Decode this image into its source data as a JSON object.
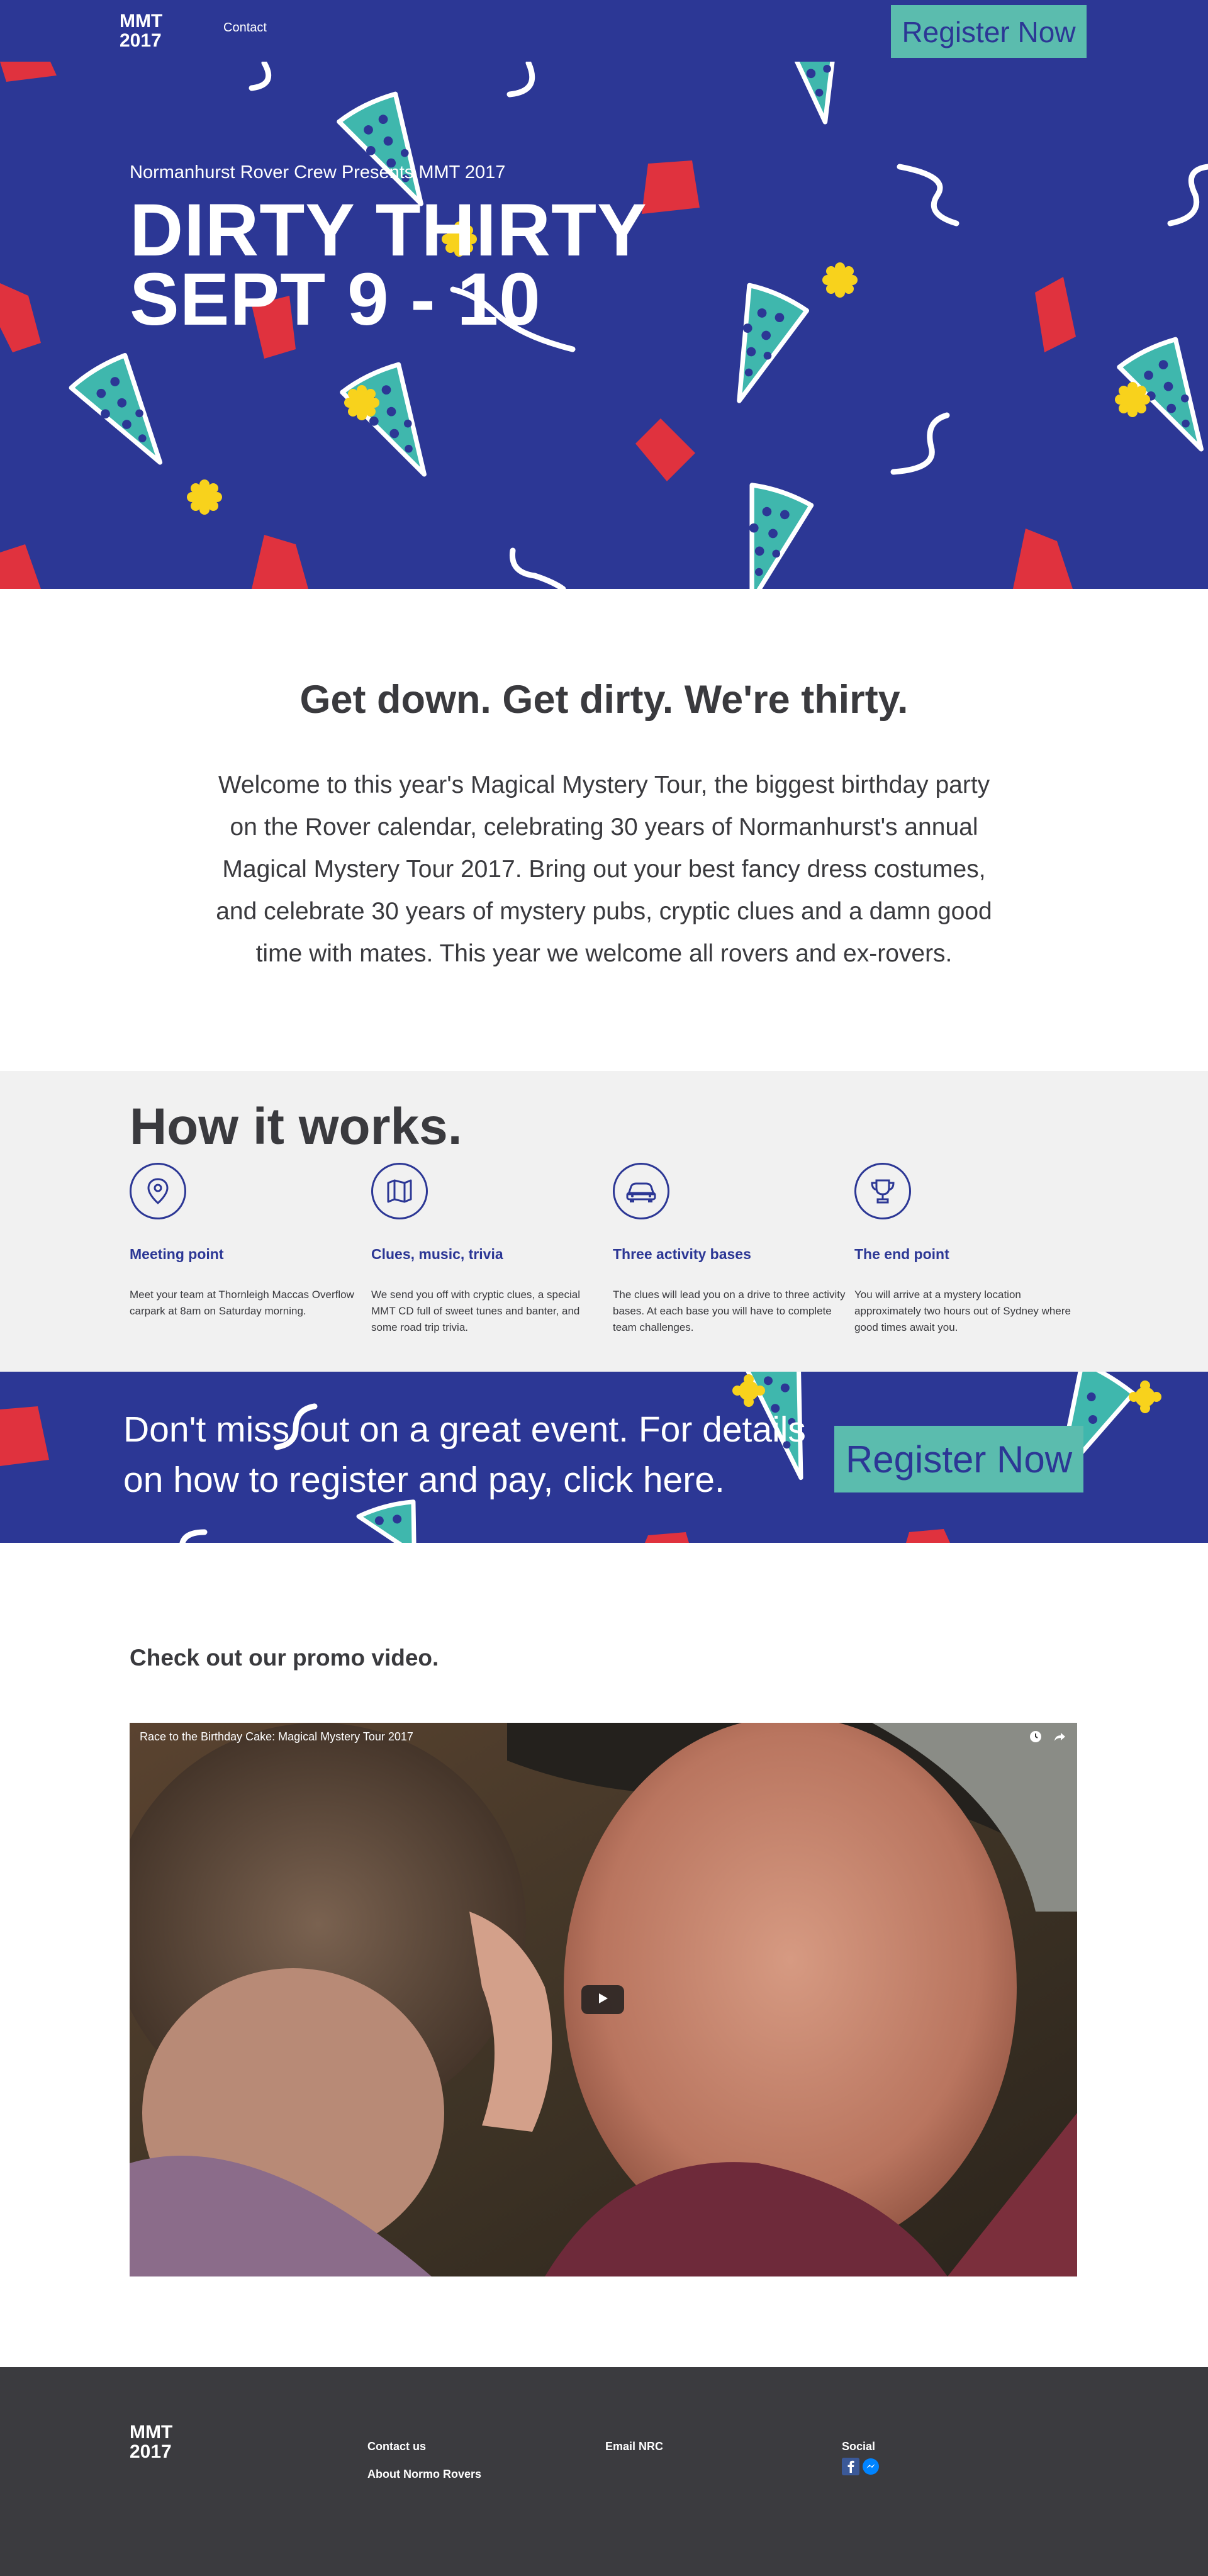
{
  "nav": {
    "logo": "MMT\n2017",
    "contact": "Contact",
    "register": "Register Now"
  },
  "hero": {
    "subtitle": "Normanhurst Rover Crew Presents MMT 2017",
    "title_line1": "DIRTY THIRTY",
    "title_line2": "SEPT 9 - 10"
  },
  "intro": {
    "heading": "Get down. Get dirty. We're thirty.",
    "body": "Welcome to this year's Magical Mystery Tour, the biggest birthday party on the Rover calendar, celebrating 30 years of Normanhurst's annual Magical Mystery Tour 2017. Bring out your best fancy dress costumes, and celebrate 30 years of mystery pubs, cryptic clues and a damn good time with mates. This year we welcome all rovers and ex-rovers."
  },
  "how": {
    "title": "How it works.",
    "steps": [
      {
        "icon": "map-pin-icon",
        "title": "Meeting point",
        "body": "Meet your team at Thornleigh Maccas Overflow carpark at 8am on Saturday morning."
      },
      {
        "icon": "map-icon",
        "title": "Clues, music, trivia",
        "body": "We send you off with cryptic clues, a special MMT CD full of sweet tunes and banter, and some road trip trivia."
      },
      {
        "icon": "car-icon",
        "title": "Three activity bases",
        "body": "The clues will lead you on a drive to three activity bases. At each base you will have to complete team challenges."
      },
      {
        "icon": "trophy-icon",
        "title": "The end point",
        "body": "You will arrive at a mystery location approximately two hours out of Sydney where good times await you."
      }
    ]
  },
  "cta": {
    "text": "Don't miss out on a great event. For details on how to register and pay, click here.",
    "button": "Register Now"
  },
  "video": {
    "heading": "Check out our promo video.",
    "title": "Race to the Birthday Cake: Magical Mystery Tour 2017"
  },
  "footer": {
    "logo": "MMT\n2017",
    "contact": "Contact us",
    "about": "About Normo Rovers",
    "email": "Email NRC",
    "social": "Social"
  },
  "colors": {
    "brand_blue": "#2c3795",
    "teal": "#5bbcae",
    "confetti_red": "#e0323e",
    "star_yellow": "#f8d21c",
    "footer": "#3b3b3f"
  }
}
